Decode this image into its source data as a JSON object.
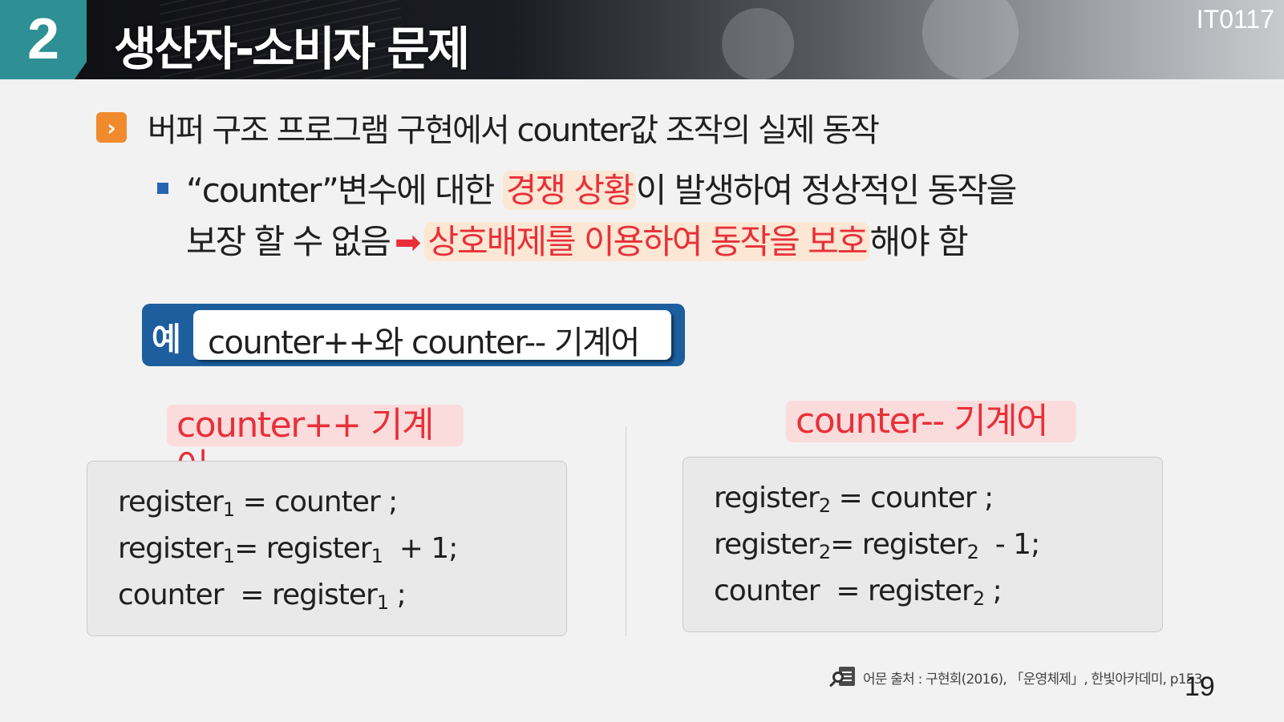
{
  "header": {
    "section_number": "2",
    "title": "생산자-소비자 문제",
    "course_code": "IT0117"
  },
  "bullet1": {
    "icon": "chevron-right-icon",
    "text": "버퍼 구조 프로그램 구현에서 counter값 조작의 실제 동작"
  },
  "bullet2": {
    "icon": "square-bullet-icon",
    "line1_pre": "“counter”변수에 대한 ",
    "line1_highlight": "경쟁 상황",
    "line1_post": "이 발생하여 정상적인 동작을",
    "line2_pre": "보장 할 수 없음",
    "arrow": "➡",
    "line2_highlight": "상호배제를 이용하여 동작을 보호",
    "line2_post": "해야 함"
  },
  "example": {
    "label": "예",
    "text": "counter++와 counter-- 기계어"
  },
  "left_machine": {
    "label": "counter++ 기계어",
    "lines": [
      {
        "a": "register",
        "a_sub": "1",
        "b": " = counter ;",
        "c": "",
        "c_sub": "",
        "d": ""
      },
      {
        "a": "register",
        "a_sub": "1",
        "b": "= register",
        "c": "",
        "c_sub": "1",
        "d": "  + 1;"
      },
      {
        "a": "counter  = register",
        "a_sub": "1",
        "b": " ;",
        "c": "",
        "c_sub": "",
        "d": ""
      }
    ]
  },
  "right_machine": {
    "label": "counter-- 기계어",
    "lines": [
      {
        "a": "register",
        "a_sub": "2",
        "b": " = counter ;",
        "c": "",
        "c_sub": "",
        "d": ""
      },
      {
        "a": "register",
        "a_sub": "2",
        "b": "= register",
        "c": "",
        "c_sub": "2",
        "d": "  - 1;"
      },
      {
        "a": "counter  = register",
        "a_sub": "2",
        "b": " ;",
        "c": "",
        "c_sub": "",
        "d": ""
      }
    ]
  },
  "footer": {
    "source": "어문 출처 : 구현회(2016), 「운영체제」, 한빛아카데미, p153",
    "page_number": "19"
  },
  "colors": {
    "accent_teal": "#2e8f94",
    "accent_orange": "#f08a2c",
    "accent_blue": "#1c5e9e",
    "highlight_red": "#e8303a"
  }
}
